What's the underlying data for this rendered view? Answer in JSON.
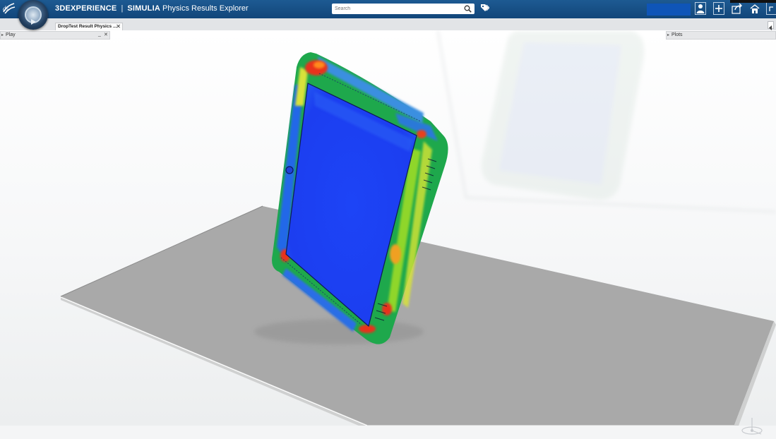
{
  "app": {
    "brand": "3DEXPERIENCE",
    "separator": "|",
    "product": "SIMULIA",
    "app_name": "Physics Results Explorer"
  },
  "search": {
    "placeholder": "Search"
  },
  "tabs": [
    {
      "label": "DropTest Result Physics ...",
      "close": "✕"
    }
  ],
  "panels": {
    "left": {
      "label": "Play",
      "minimize": "_",
      "close": "✕"
    },
    "right": {
      "label": "Plots"
    }
  },
  "icons": {
    "logo": "ds-logo-icon",
    "compass": "compass-icon",
    "search": "search-icon",
    "tag": "tag-icon",
    "user": "user-icon",
    "add": "plus-icon",
    "share": "share-icon",
    "home": "home-icon",
    "more": "more-icon"
  },
  "colors": {
    "topbar": "#12467a",
    "user_box": "#0f55b8",
    "platform": "#a9a9a9",
    "field_low": "#1f3cf0",
    "field_mid": "#22c35a",
    "field_high": "#e8301f"
  }
}
